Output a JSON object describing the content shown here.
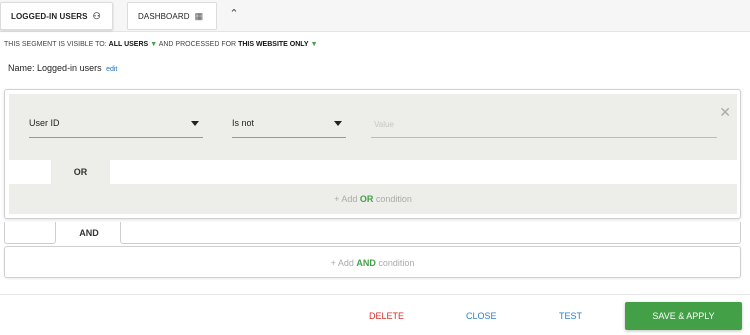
{
  "tabs": {
    "active_label": "LOGGED-IN USERS",
    "dashboard_label": "DASHBOARD"
  },
  "icons": {
    "segment_icon": "users-icon",
    "dashboard_icon": "grid-icon",
    "collapse_icon": "double-chevron-up-icon",
    "remove_icon": "close-icon"
  },
  "visibility": {
    "prefix": "THIS SEGMENT IS VISIBLE TO:",
    "visible_to": "ALL USERS",
    "middle": "AND PROCESSED FOR",
    "processed_for": "THIS WEBSITE ONLY"
  },
  "segment": {
    "name_label": "Name:",
    "name_value": "Logged-in users",
    "edit_label": "edit"
  },
  "condition": {
    "attribute": "User ID",
    "comparison": "Is not",
    "value": "",
    "value_placeholder": "Value"
  },
  "or_label": "OR",
  "add_or": {
    "prefix": "+ Add",
    "keyword": "OR",
    "suffix": "condition"
  },
  "and_label": "AND",
  "add_and": {
    "prefix": "+ Add",
    "keyword": "AND",
    "suffix": "condition"
  },
  "footer": {
    "delete": "DELETE",
    "close": "CLOSE",
    "test": "TEST",
    "save_apply": "SAVE & APPLY"
  },
  "colors": {
    "accent_green": "#43a047",
    "delete_red": "#d4322c",
    "link_blue": "#2f80c2"
  }
}
